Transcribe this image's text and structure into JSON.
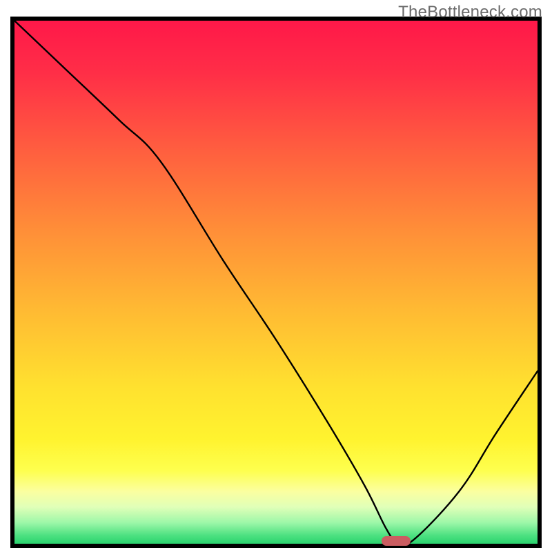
{
  "watermark": "TheBottleneck.com",
  "chart_data": {
    "type": "line",
    "title": "",
    "xlabel": "",
    "ylabel": "",
    "xlim": [
      0,
      100
    ],
    "ylim": [
      0,
      100
    ],
    "series": [
      {
        "name": "bottleneck-curve",
        "x": [
          0,
          10,
          20,
          28,
          40,
          50,
          60,
          67,
          71,
          73,
          76,
          85,
          92,
          100
        ],
        "y": [
          100,
          90.5,
          81,
          73,
          54,
          39,
          23,
          11,
          3,
          0.5,
          0.5,
          10,
          21,
          33
        ]
      }
    ],
    "annotations": [
      {
        "name": "optimal-marker",
        "x": 73,
        "y": 0.5,
        "shape": "pill",
        "color": "#cb5d61"
      }
    ],
    "background_gradient": {
      "stops": [
        {
          "pos": 0.0,
          "color": "#ff1849"
        },
        {
          "pos": 0.1,
          "color": "#ff2e47"
        },
        {
          "pos": 0.25,
          "color": "#ff5f3f"
        },
        {
          "pos": 0.4,
          "color": "#ff8e38"
        },
        {
          "pos": 0.55,
          "color": "#ffb933"
        },
        {
          "pos": 0.7,
          "color": "#ffe12f"
        },
        {
          "pos": 0.8,
          "color": "#fff32f"
        },
        {
          "pos": 0.86,
          "color": "#feff4e"
        },
        {
          "pos": 0.9,
          "color": "#fbffa0"
        },
        {
          "pos": 0.93,
          "color": "#e0ffb8"
        },
        {
          "pos": 0.96,
          "color": "#9cf7a8"
        },
        {
          "pos": 0.985,
          "color": "#4ae07f"
        },
        {
          "pos": 1.0,
          "color": "#2bd36f"
        }
      ]
    },
    "colors": {
      "curve": "#000000",
      "frame": "#000000",
      "marker": "#cb5d61"
    }
  }
}
